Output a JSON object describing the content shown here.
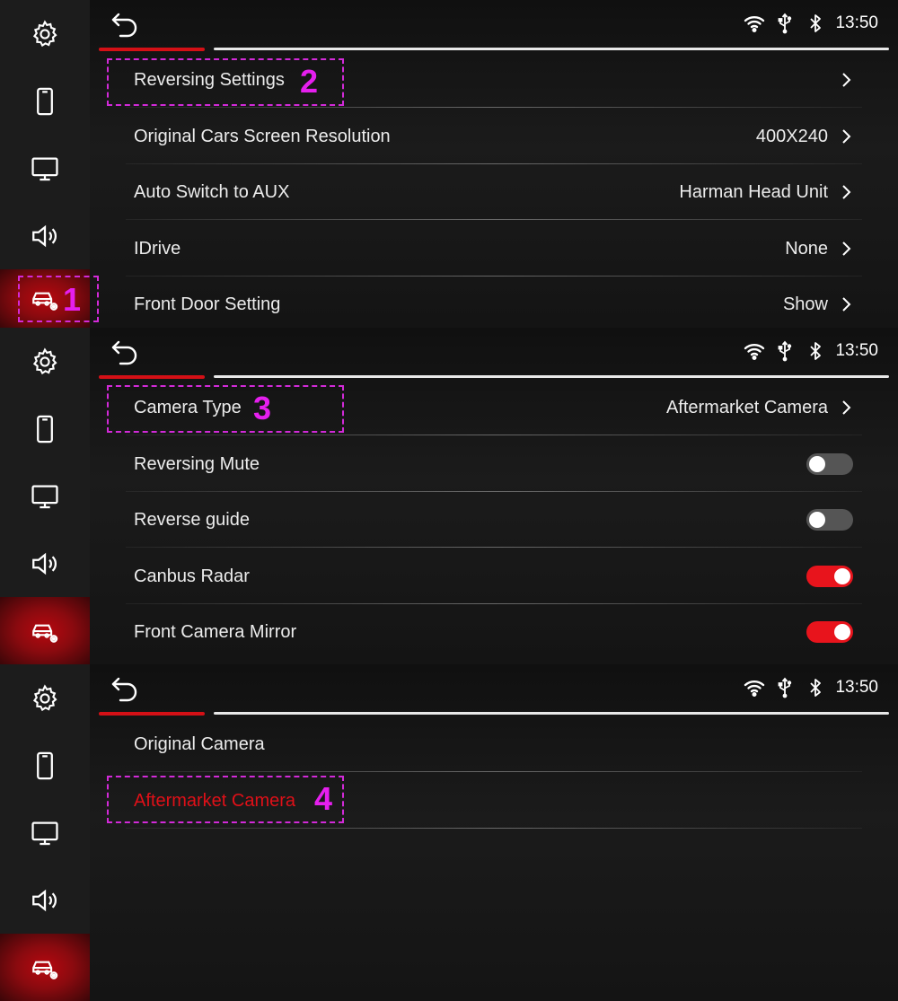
{
  "status": {
    "time": "13:50"
  },
  "sidebar": {
    "items": [
      {
        "icon": "gear-icon"
      },
      {
        "icon": "phone-icon"
      },
      {
        "icon": "monitor-icon"
      },
      {
        "icon": "speaker-icon"
      },
      {
        "icon": "car-settings-icon"
      }
    ],
    "active_index": 4
  },
  "colors": {
    "accent": "#d41016",
    "callout": "#d22ad8",
    "toggle_on": "#e8141c",
    "toggle_off": "#555555"
  },
  "screen1": {
    "rows": [
      {
        "label": "Reversing Settings",
        "value": ""
      },
      {
        "label": "Original Cars Screen Resolution",
        "value": "400X240"
      },
      {
        "label": "Auto Switch to AUX",
        "value": "Harman Head Unit"
      },
      {
        "label": "IDrive",
        "value": "None"
      },
      {
        "label": "Front Door Setting",
        "value": "Show"
      }
    ]
  },
  "screen2": {
    "rows": [
      {
        "label": "Camera Type",
        "value": "Aftermarket Camera"
      },
      {
        "label": "Reversing Mute",
        "on": false
      },
      {
        "label": "Reverse guide",
        "on": false
      },
      {
        "label": "Canbus Radar",
        "on": true
      },
      {
        "label": "Front Camera Mirror",
        "on": true
      }
    ]
  },
  "screen3": {
    "rows": [
      {
        "label": "Original Camera",
        "selected": false
      },
      {
        "label": "Aftermarket Camera",
        "selected": true
      }
    ]
  },
  "callouts": {
    "c1": "1",
    "c2": "2",
    "c3": "3",
    "c4": "4"
  }
}
